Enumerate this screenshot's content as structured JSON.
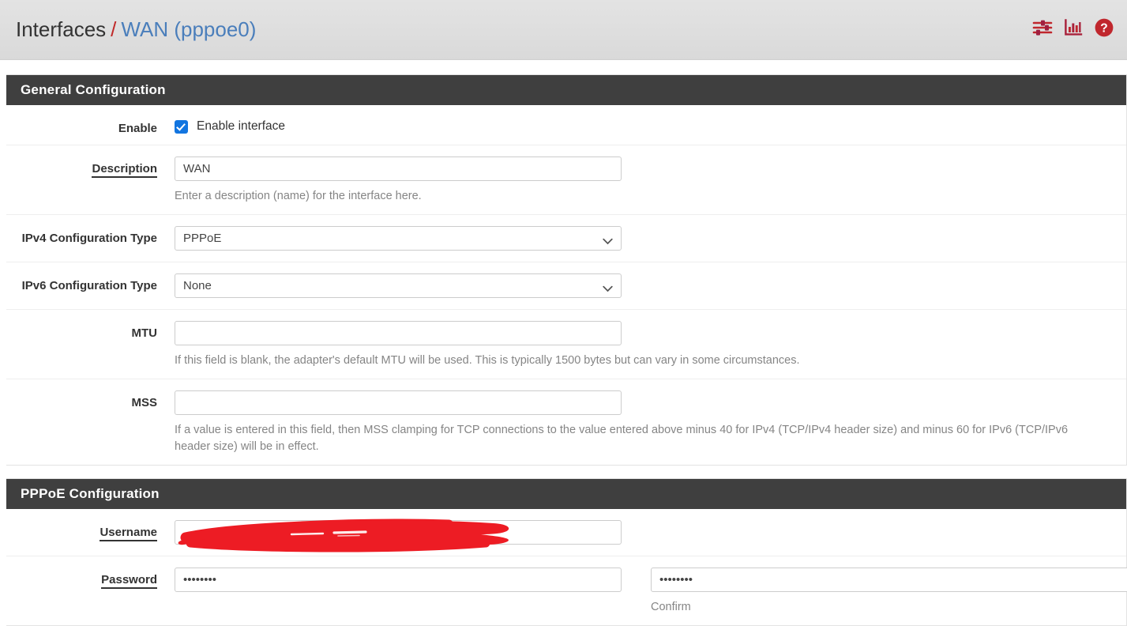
{
  "header": {
    "breadcrumb_root": "Interfaces",
    "breadcrumb_separator": "/",
    "breadcrumb_current": "WAN (pppoe0)",
    "icons": [
      {
        "name": "sliders-icon",
        "label": "Interface settings"
      },
      {
        "name": "chart-icon",
        "label": "Interface statistics"
      },
      {
        "name": "help-icon",
        "label": "Help"
      }
    ],
    "accent_color": "#c02929",
    "link_color": "#4a7ebb"
  },
  "general_configuration": {
    "title": "General Configuration",
    "enable": {
      "label": "Enable",
      "checkbox_label": "Enable interface",
      "checked": true,
      "checkbox_color": "#1275e0"
    },
    "description": {
      "label": "Description",
      "value": "WAN",
      "help": "Enter a description (name) for the interface here."
    },
    "ipv4_configuration_type": {
      "label": "IPv4 Configuration Type",
      "value": "PPPoE"
    },
    "ipv6_configuration_type": {
      "label": "IPv6 Configuration Type",
      "value": "None"
    },
    "mtu": {
      "label": "MTU",
      "value": "",
      "help": "If this field is blank, the adapter's default MTU will be used. This is typically 1500 bytes but can vary in some circumstances."
    },
    "mss": {
      "label": "MSS",
      "value": "",
      "help": "If a value is entered in this field, then MSS clamping for TCP connections to the value entered above minus 40 for IPv4 (TCP/IPv4 header size) and minus 60 for IPv6 (TCP/IPv6 header size) will be in effect."
    }
  },
  "pppoe_configuration": {
    "title": "PPPoE Configuration",
    "username": {
      "label": "Username",
      "value": "",
      "redacted": true,
      "redaction_color": "#ED1C24"
    },
    "password": {
      "label": "Password",
      "value": "••••••••",
      "confirm_value": "••••••••",
      "confirm_help": "Confirm"
    }
  }
}
